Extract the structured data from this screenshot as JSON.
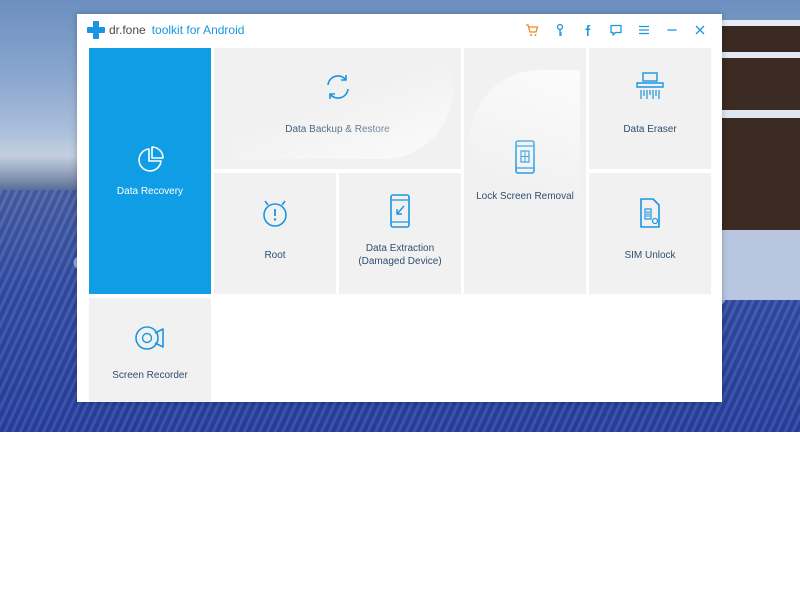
{
  "app": {
    "name": "dr.fone",
    "product": "toolkit for Android"
  },
  "titlebar": {
    "buttons": [
      {
        "id": "cart",
        "icon": "cart-icon",
        "color": "#f08a24"
      },
      {
        "id": "key",
        "icon": "key-icon",
        "color": "#1a96e0"
      },
      {
        "id": "facebook",
        "icon": "facebook-icon",
        "color": "#1a96e0"
      },
      {
        "id": "feedback",
        "icon": "chat-icon",
        "color": "#1a96e0"
      },
      {
        "id": "menu",
        "icon": "menu-icon",
        "color": "#1a96e0"
      },
      {
        "id": "minimize",
        "icon": "minimize-icon",
        "color": "#1a96e0"
      },
      {
        "id": "close",
        "icon": "close-icon",
        "color": "#1a96e0"
      }
    ]
  },
  "tiles": {
    "recovery": {
      "label": "Data Recovery",
      "icon": "pie-chart-icon",
      "active": true
    },
    "backup": {
      "label": "Data Backup & Restore",
      "icon": "sync-icon"
    },
    "lock": {
      "label": "Lock Screen Removal",
      "icon": "phone-lock-icon"
    },
    "eraser": {
      "label": "Data Eraser",
      "icon": "shredder-icon"
    },
    "root": {
      "label": "Root",
      "icon": "android-alert-icon"
    },
    "extract": {
      "label": "Data Extraction (Damaged Device)",
      "icon": "phone-extract-icon"
    },
    "sim": {
      "label": "SIM Unlock",
      "icon": "sim-card-icon"
    },
    "recorder": {
      "label": "Screen Recorder",
      "icon": "video-record-icon"
    }
  },
  "colors": {
    "accent": "#0f9ee6",
    "brand": "#1a96e0",
    "cart": "#f08a24",
    "tile_bg": "#f1f1f1",
    "tile_text": "#2f4f6f"
  }
}
